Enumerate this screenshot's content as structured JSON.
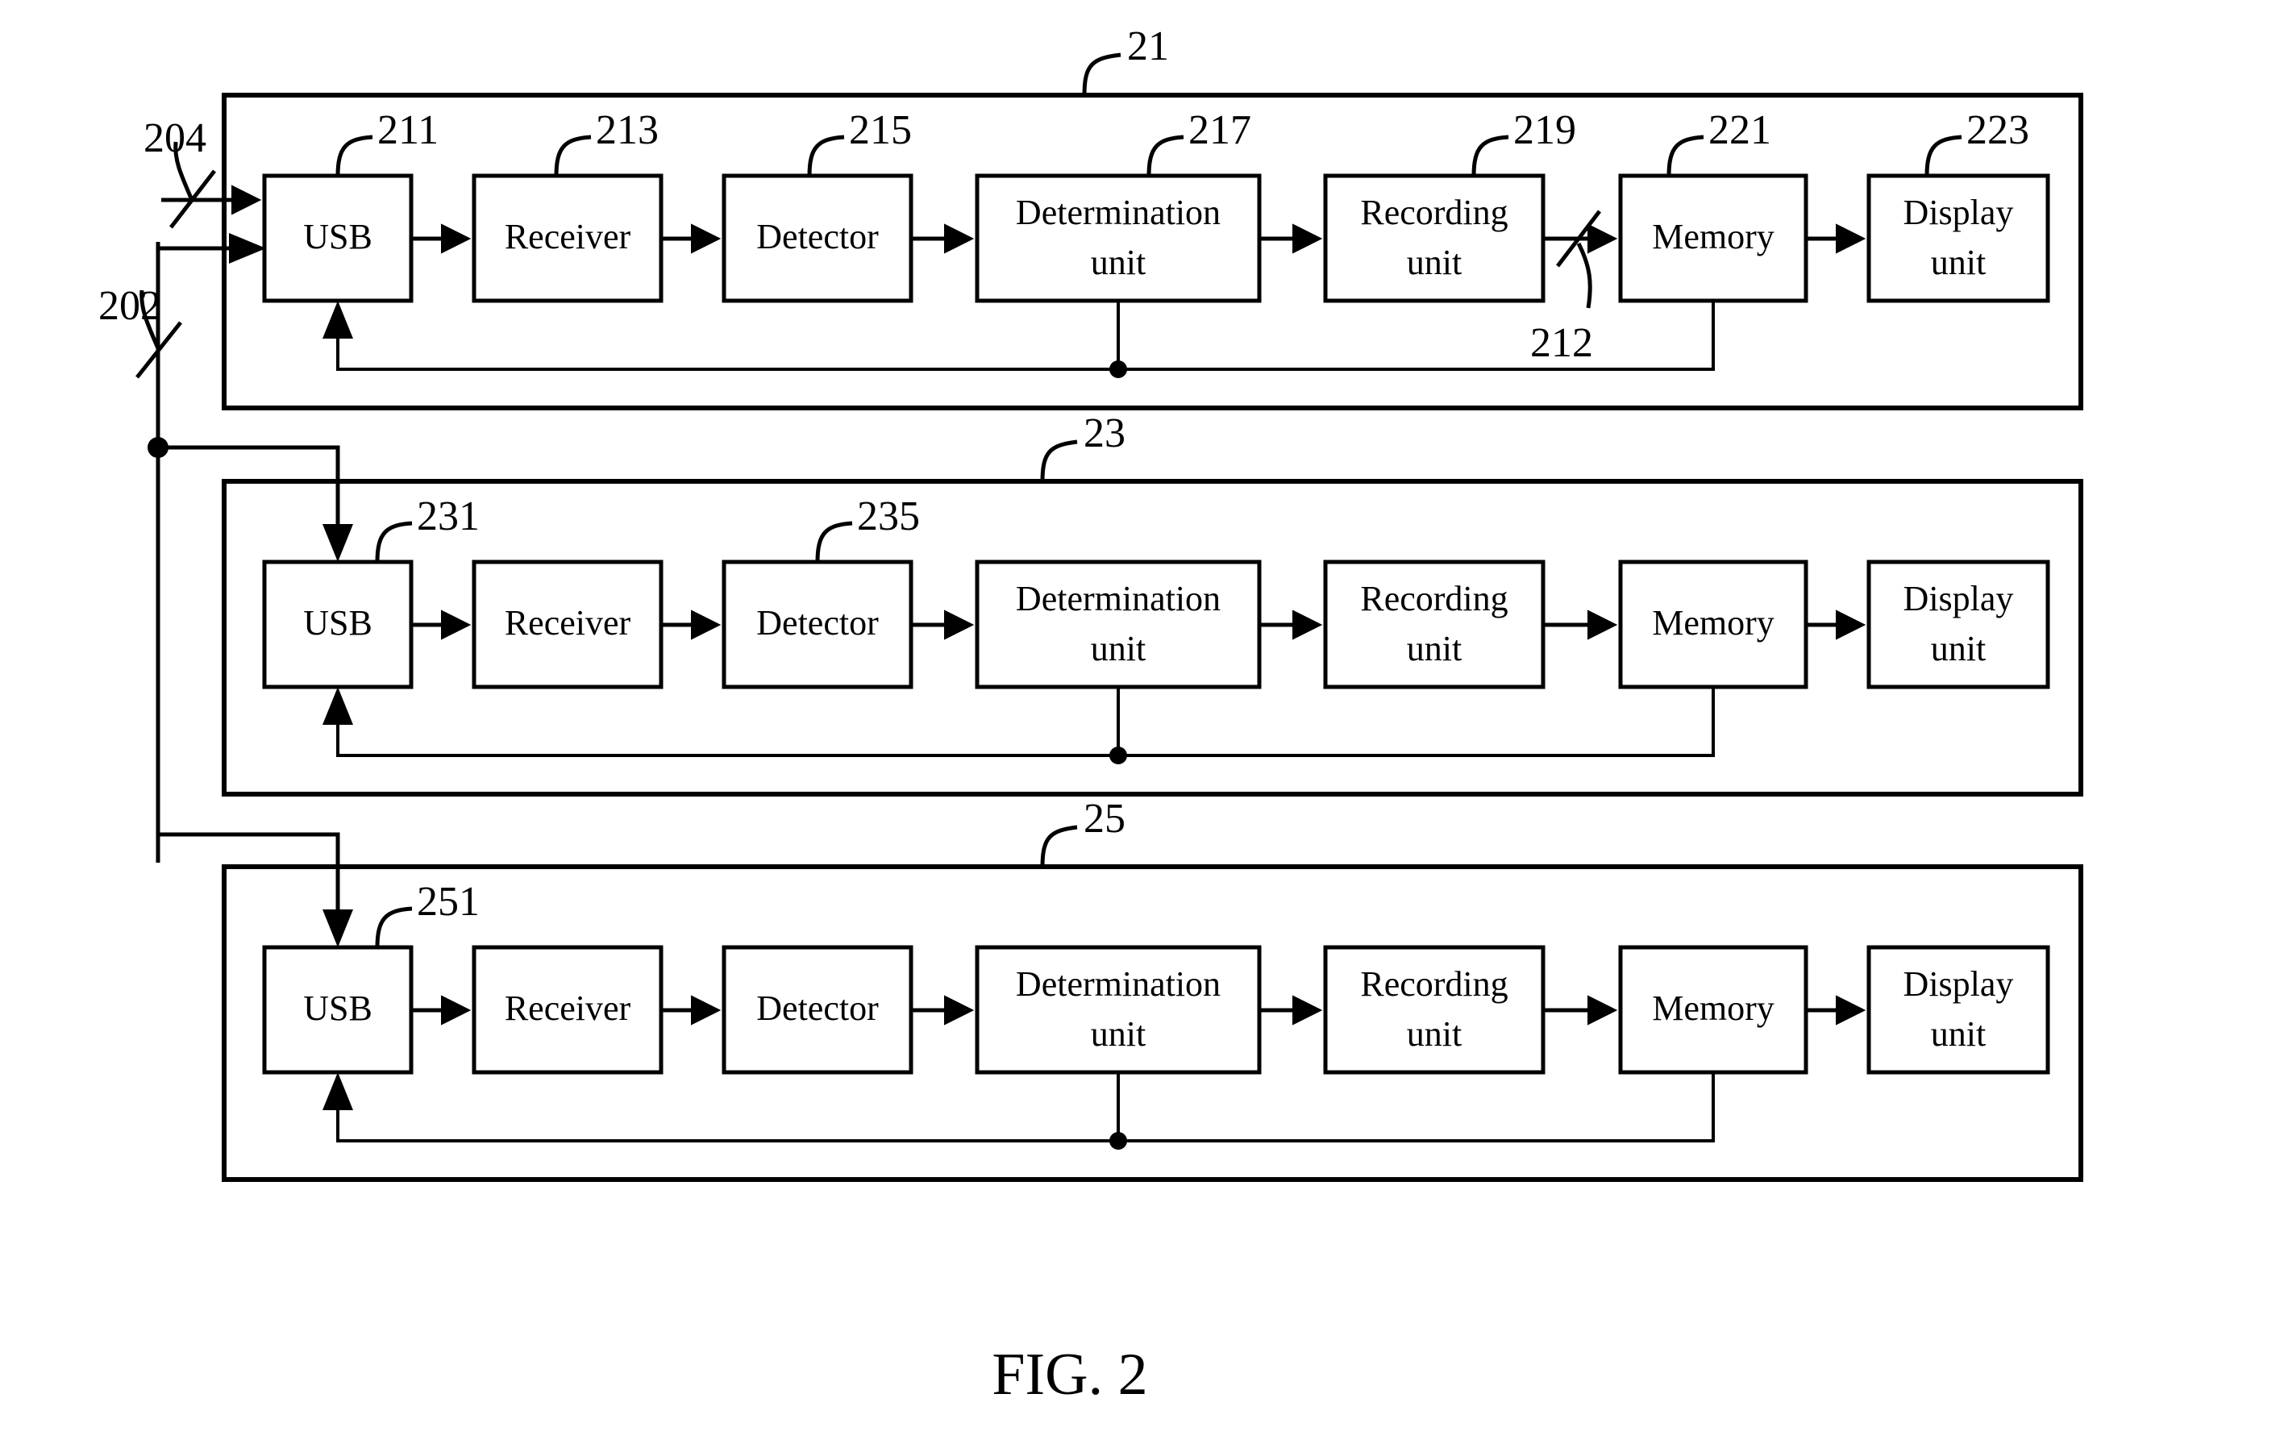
{
  "figure": {
    "caption": "FIG. 2",
    "type": "patent-block-diagram"
  },
  "external_refs": [
    {
      "id": "ref-204",
      "label": "204"
    },
    {
      "id": "ref-202",
      "label": "202"
    },
    {
      "id": "ref-212",
      "label": "212"
    }
  ],
  "groups": [
    {
      "id": "group-21",
      "label": "21",
      "usb_ref": "211",
      "blocks": [
        {
          "name": "usb",
          "label": "USB",
          "ref": "211"
        },
        {
          "name": "receiver",
          "label": "Receiver",
          "ref": "213"
        },
        {
          "name": "detector",
          "label": "Detector",
          "ref": "215"
        },
        {
          "name": "determination-unit",
          "label": "Determination unit",
          "ref": "217"
        },
        {
          "name": "recording-unit",
          "label": "Recording unit",
          "ref": "219"
        },
        {
          "name": "memory",
          "label": "Memory",
          "ref": "221"
        },
        {
          "name": "display-unit",
          "label": "Display unit",
          "ref": "223"
        }
      ]
    },
    {
      "id": "group-23",
      "label": "23",
      "usb_ref": "231",
      "blocks": [
        {
          "name": "usb",
          "label": "USB",
          "ref": "231"
        },
        {
          "name": "receiver",
          "label": "Receiver",
          "ref": ""
        },
        {
          "name": "detector",
          "label": "Detector",
          "ref": "235"
        },
        {
          "name": "determination-unit",
          "label": "Determination unit",
          "ref": ""
        },
        {
          "name": "recording-unit",
          "label": "Recording unit",
          "ref": ""
        },
        {
          "name": "memory",
          "label": "Memory",
          "ref": ""
        },
        {
          "name": "display-unit",
          "label": "Display unit",
          "ref": ""
        }
      ]
    },
    {
      "id": "group-25",
      "label": "25",
      "usb_ref": "251",
      "blocks": [
        {
          "name": "usb",
          "label": "USB",
          "ref": "251"
        },
        {
          "name": "receiver",
          "label": "Receiver",
          "ref": ""
        },
        {
          "name": "detector",
          "label": "Detector",
          "ref": ""
        },
        {
          "name": "determination-unit",
          "label": "Determination unit",
          "ref": ""
        },
        {
          "name": "recording-unit",
          "label": "Recording unit",
          "ref": ""
        },
        {
          "name": "memory",
          "label": "Memory",
          "ref": ""
        },
        {
          "name": "display-unit",
          "label": "Display unit",
          "ref": ""
        }
      ]
    }
  ],
  "block_text": {
    "usb": "USB",
    "receiver": "Receiver",
    "detector": "Detector",
    "determination_line1": "Determination",
    "determination_line2": "unit",
    "recording_line1": "Recording",
    "recording_line2": "unit",
    "memory": "Memory",
    "display_line1": "Display",
    "display_line2": "unit"
  },
  "refs": {
    "r21": "21",
    "r23": "23",
    "r25": "25",
    "r211": "211",
    "r213": "213",
    "r215": "215",
    "r217": "217",
    "r219": "219",
    "r221": "221",
    "r223": "223",
    "r231": "231",
    "r235": "235",
    "r251": "251",
    "r202": "202",
    "r204": "204",
    "r212": "212"
  },
  "colors": {
    "stroke": "#000000",
    "background": "#ffffff"
  }
}
